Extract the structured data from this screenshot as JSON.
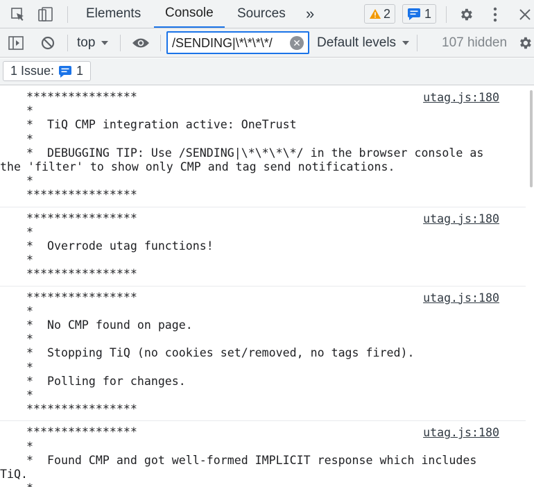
{
  "tabbar": {
    "tabs": [
      {
        "label": "Elements"
      },
      {
        "label": "Console"
      },
      {
        "label": "Sources"
      }
    ],
    "more_tabs": "»",
    "warnings_count": "2",
    "messages_count": "1"
  },
  "toolbar": {
    "context": "top",
    "filter_value": "/SENDING|\\*\\*\\*\\*/",
    "levels": "Default levels",
    "hidden": "107 hidden"
  },
  "issues": {
    "label": "1 Issue:",
    "count": "1"
  },
  "messages": [
    {
      "source": "utag.js:180",
      "lines": [
        "****************",
        "*",
        "*  TiQ CMP integration active: OneTrust",
        "*",
        "*  DEBUGGING TIP: Use /SENDING|\\*\\*\\*\\*/ in the browser console as the 'filter' to show only CMP and tag send notifications.",
        "*",
        "****************"
      ]
    },
    {
      "source": "utag.js:180",
      "lines": [
        "****************",
        "*",
        "*  Overrode utag functions!",
        "*",
        "****************"
      ]
    },
    {
      "source": "utag.js:180",
      "lines": [
        "****************",
        "*",
        "*  No CMP found on page.",
        "*",
        "*  Stopping TiQ (no cookies set/removed, no tags fired).",
        "*",
        "*  Polling for changes.",
        "*",
        "****************"
      ]
    },
    {
      "source": "utag.js:180",
      "lines": [
        "****************",
        "*",
        "*  Found CMP and got well-formed IMPLICIT response which includes TiQ.",
        "*"
      ]
    }
  ],
  "colors": {
    "accent": "#1a73e8",
    "warning": "#f29900",
    "toolbar_bg": "#f1f3f4"
  }
}
